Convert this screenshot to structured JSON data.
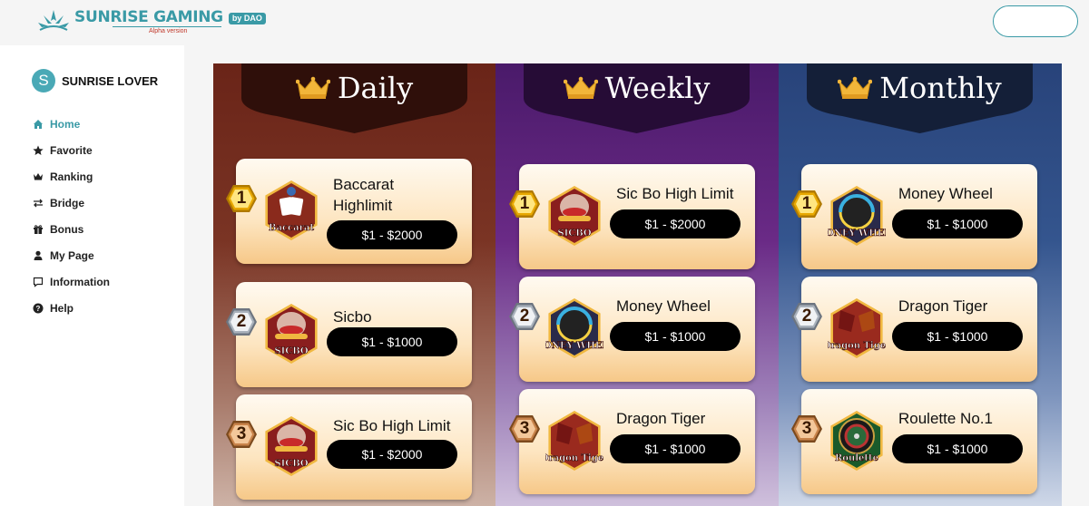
{
  "brand": {
    "name": "SUNRISE GAMING",
    "by": "by DAO",
    "sub": "Alpha version",
    "accent": "#3a9aa6"
  },
  "user": {
    "initial": "S",
    "name": "SUNRISE LOVER"
  },
  "nav": [
    {
      "label": "Home",
      "icon": "home-icon",
      "active": true
    },
    {
      "label": "Favorite",
      "icon": "star-icon"
    },
    {
      "label": "Ranking",
      "icon": "crown-icon"
    },
    {
      "label": "Bridge",
      "icon": "bridge-icon"
    },
    {
      "label": "Bonus",
      "icon": "gift-icon"
    },
    {
      "label": "My Page",
      "icon": "person-icon"
    },
    {
      "label": "Information",
      "icon": "chat-icon"
    },
    {
      "label": "Help",
      "icon": "help-icon"
    }
  ],
  "columns": [
    {
      "title": "Daily",
      "cards": [
        {
          "rank": "1",
          "name": "Baccarat Highlimit",
          "bet": "$1 - $2000",
          "icon_label": "Baccarat",
          "icon": "baccarat-icon"
        },
        {
          "rank": "2",
          "name": "Sicbo",
          "bet": "$1 - $1000",
          "icon_label": "SICBO",
          "icon": "sicbo-icon"
        },
        {
          "rank": "3",
          "name": "Sic Bo High Limit",
          "bet": "$1 - $2000",
          "icon_label": "SICBO",
          "icon": "sicbo-icon"
        }
      ]
    },
    {
      "title": "Weekly",
      "cards": [
        {
          "rank": "1",
          "name": "Sic Bo High Limit",
          "bet": "$1 - $2000",
          "icon_label": "SICBO",
          "icon": "sicbo-icon"
        },
        {
          "rank": "2",
          "name": "Money Wheel",
          "bet": "$1 - $1000",
          "icon_label": "MONEY WHEEL",
          "icon": "money-wheel-icon"
        },
        {
          "rank": "3",
          "name": "Dragon Tiger",
          "bet": "$1 - $1000",
          "icon_label": "Dragon Tiger",
          "icon": "dragon-tiger-icon"
        }
      ]
    },
    {
      "title": "Monthly",
      "cards": [
        {
          "rank": "1",
          "name": "Money Wheel",
          "bet": "$1 - $1000",
          "icon_label": "MONEY WHEEL",
          "icon": "money-wheel-icon"
        },
        {
          "rank": "2",
          "name": "Dragon Tiger",
          "bet": "$1 - $1000",
          "icon_label": "Dragon Tiger",
          "icon": "dragon-tiger-icon"
        },
        {
          "rank": "3",
          "name": "Roulette No.1",
          "bet": "$1 - $1000",
          "icon_label": "Roulette",
          "icon": "roulette-icon"
        }
      ]
    }
  ]
}
